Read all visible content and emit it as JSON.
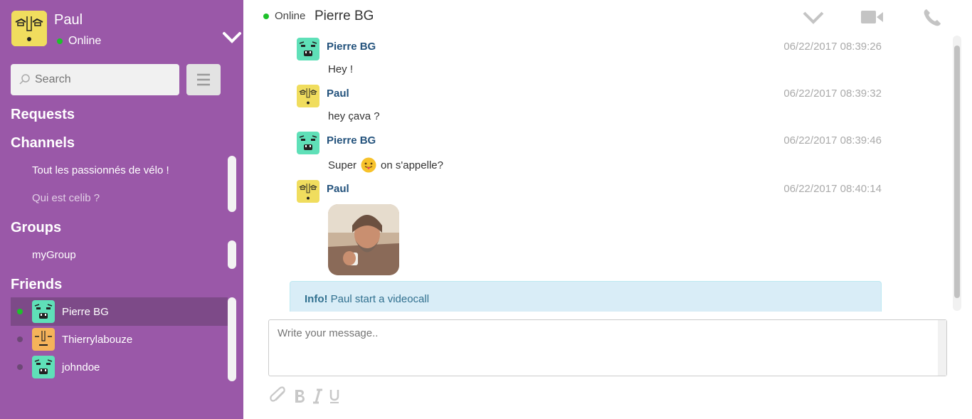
{
  "me": {
    "name": "Paul",
    "status": "Online"
  },
  "search": {
    "placeholder": "Search"
  },
  "sections": {
    "requests": "Requests",
    "channels": "Channels",
    "groups": "Groups",
    "friends": "Friends"
  },
  "channels": [
    "Tout les passionnés de vélo !",
    "Qui est celib ?"
  ],
  "groups": [
    "myGroup"
  ],
  "friends": [
    {
      "name": "Pierre BG",
      "online": true
    },
    {
      "name": "Thierrylabouze",
      "online": false
    },
    {
      "name": "johndoe",
      "online": false
    }
  ],
  "conversation": {
    "status": "Online",
    "title": "Pierre BG"
  },
  "messages": [
    {
      "author": "Pierre BG",
      "time": "06/22/2017 08:39:26",
      "text": "Hey !"
    },
    {
      "author": "Paul",
      "time": "06/22/2017 08:39:32",
      "text": "hey çava ?"
    },
    {
      "author": "Pierre BG",
      "time": "06/22/2017 08:39:46",
      "text_before": "Super",
      "text_after": "on s'appelle?"
    },
    {
      "author": "Paul",
      "time": "06/22/2017 08:40:14"
    }
  ],
  "info": {
    "label": "Info!",
    "text": "Paul start a videocall"
  },
  "composer": {
    "placeholder": "Write your message.."
  },
  "colors": {
    "sidebar": "#9a58a8",
    "active_friend": "#7d4a88",
    "author": "#23527c",
    "online": "#1dc12a"
  },
  "icons": [
    "chevron-down-icon",
    "search-icon",
    "hamburger-menu-icon",
    "video-camera-icon",
    "phone-icon",
    "paperclip-icon",
    "bold-icon",
    "italic-icon",
    "underline-icon"
  ]
}
